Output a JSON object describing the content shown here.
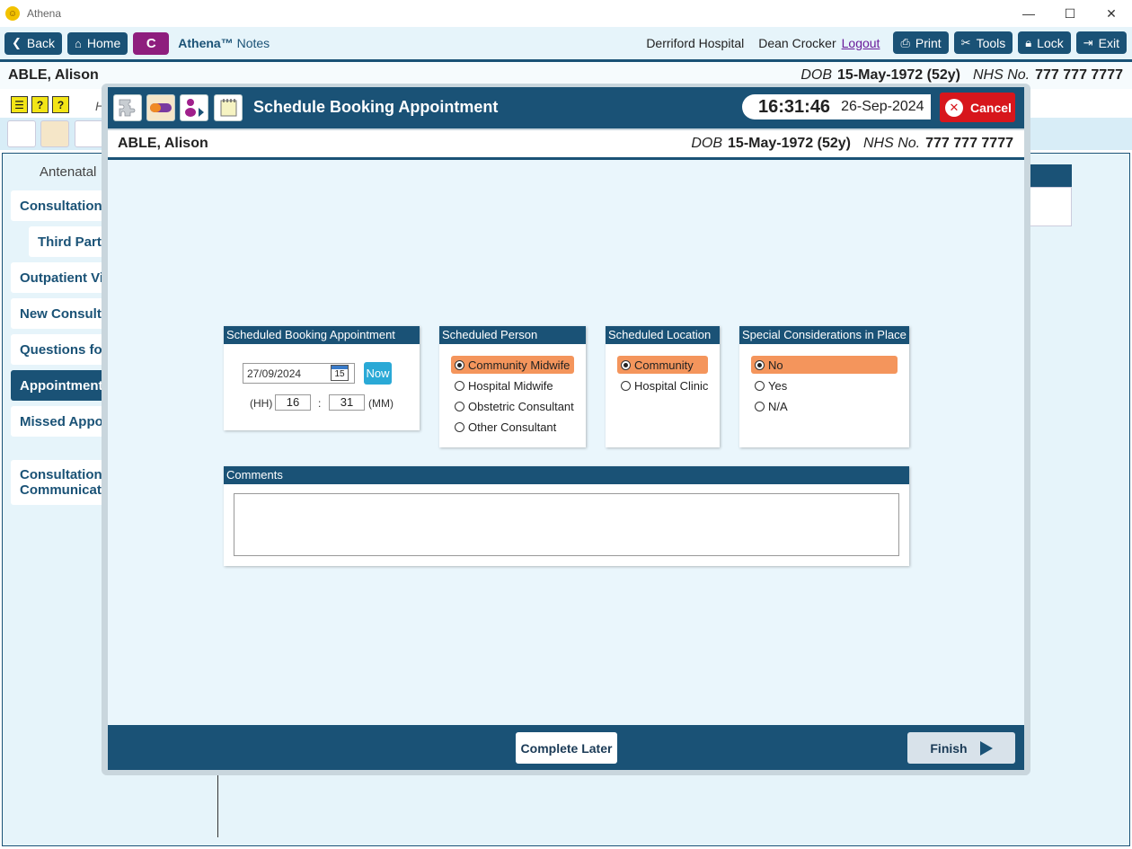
{
  "window": {
    "title": "Athena",
    "minimize": "—",
    "maximize": "☐",
    "close": "✕"
  },
  "toolbar": {
    "back": "Back",
    "home": "Home",
    "c": "C",
    "brand_name": "Athena™",
    "brand_suffix": " Notes",
    "hospital": "Derriford Hospital",
    "user": "Dean Crocker",
    "logout": "Logout",
    "print": "Print",
    "tools": "Tools",
    "lock": "Lock",
    "exit": "Exit"
  },
  "patient": {
    "name": "ABLE, Alison",
    "dob_label": "DOB",
    "dob": "15-May-1972 (52y)",
    "nhs_label": "NHS No.",
    "nhs": "777 777 7777"
  },
  "background": {
    "h_text": "H",
    "nav_head": "Antenatal",
    "nav": [
      "Consultation I",
      "Third Party",
      "Outpatient Vis",
      "New Consulta",
      "Questions for",
      "Appointments",
      "Missed Appoi",
      "Consultation",
      "Communicatio"
    ]
  },
  "modal": {
    "title": "Schedule Booking Appointment",
    "time": "16:31:46",
    "date": "26-Sep-2024",
    "cancel": "Cancel",
    "complete_later": "Complete Later",
    "finish": "Finish"
  },
  "booking": {
    "header": "Scheduled Booking Appointment",
    "date_value": "27/09/2024",
    "cal_day": "15",
    "now": "Now",
    "hh_label": "(HH)",
    "hh_value": "16",
    "colon": ":",
    "mm_value": "31",
    "mm_label": "(MM)"
  },
  "person": {
    "header": "Scheduled Person",
    "options": [
      "Community Midwife",
      "Hospital Midwife",
      "Obstetric Consultant",
      "Other Consultant"
    ],
    "selected": "Community Midwife"
  },
  "location": {
    "header": "Scheduled Location",
    "options": [
      "Community",
      "Hospital Clinic"
    ],
    "selected": "Community"
  },
  "special": {
    "header": "Special Considerations in Place",
    "options": [
      "No",
      "Yes",
      "N/A"
    ],
    "selected": "No"
  },
  "comments": {
    "header": "Comments",
    "value": ""
  },
  "colors": {
    "primary": "#1a5276",
    "selected": "#f4955c",
    "cancel": "#d7161c",
    "now": "#2aa9d6",
    "c_button": "#8e1e7e"
  }
}
